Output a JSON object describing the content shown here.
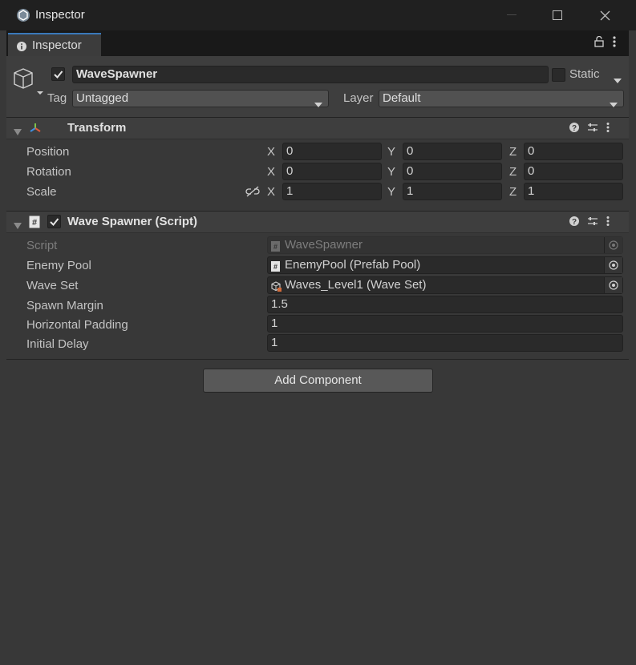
{
  "window": {
    "title": "Inspector",
    "minimize_icon": "minimize-icon",
    "maximize_icon": "maximize-icon",
    "close_icon": "close-icon"
  },
  "tab": {
    "label": "Inspector",
    "icon": "info-icon"
  },
  "gameobject": {
    "active": true,
    "name": "WaveSpawner",
    "static_label": "Static",
    "static_checked": false,
    "tag_label": "Tag",
    "tag_value": "Untagged",
    "layer_label": "Layer",
    "layer_value": "Default"
  },
  "transform": {
    "title": "Transform",
    "rows": [
      {
        "label": "Position",
        "x": "0",
        "y": "0",
        "z": "0"
      },
      {
        "label": "Rotation",
        "x": "0",
        "y": "0",
        "z": "0"
      },
      {
        "label": "Scale",
        "x": "1",
        "y": "1",
        "z": "1"
      }
    ],
    "axis_x": "X",
    "axis_y": "Y",
    "axis_z": "Z"
  },
  "wave_spawner": {
    "title": "Wave Spawner (Script)",
    "enabled": true,
    "script_label": "Script",
    "script_value": "WaveSpawner",
    "enemy_pool_label": "Enemy Pool",
    "enemy_pool_value": "EnemyPool (Prefab Pool)",
    "wave_set_label": "Wave Set",
    "wave_set_value": "Waves_Level1 (Wave Set)",
    "spawn_margin_label": "Spawn Margin",
    "spawn_margin_value": "1.5",
    "horizontal_padding_label": "Horizontal Padding",
    "horizontal_padding_value": "1",
    "initial_delay_label": "Initial Delay",
    "initial_delay_value": "1"
  },
  "add_component_label": "Add Component"
}
